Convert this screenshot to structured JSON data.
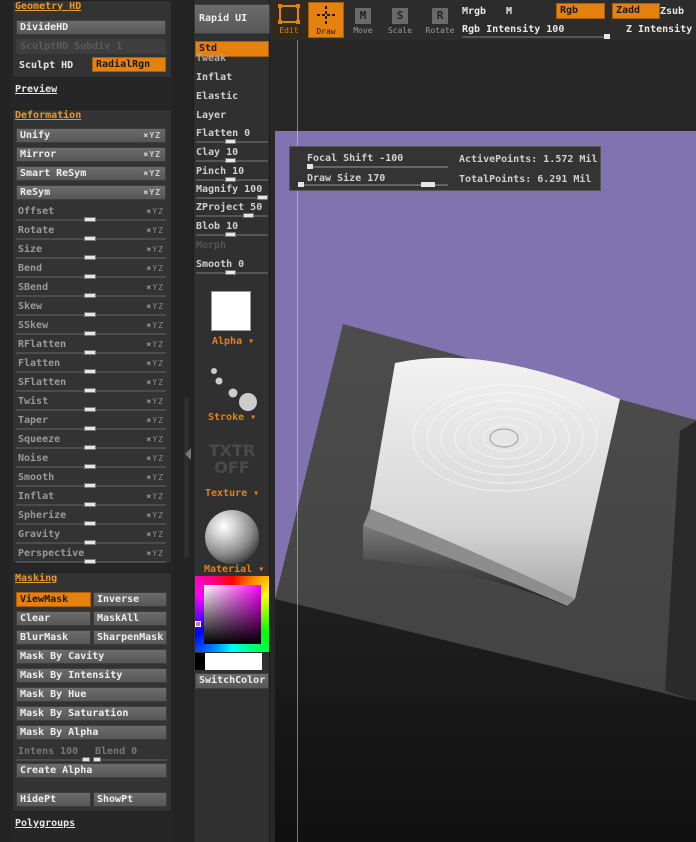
{
  "left_panel": {
    "geometry": {
      "title": "Geometry HD",
      "divide": "DivideHD",
      "sculpt_subdiv": "SculptHD Subdiv 1",
      "sculpt_hd": "Sculpt HD",
      "radial_rgn": "RadialRgn"
    },
    "preview": "Preview",
    "deformation": {
      "title": "Deformation",
      "buttons": [
        "Unify",
        "Mirror",
        "Smart ReSym",
        "ReSym"
      ],
      "xyz": "✖YZ",
      "sliders": [
        "Offset",
        "Rotate",
        "Size",
        "Bend",
        "SBend",
        "Skew",
        "SSkew",
        "RFlatten",
        "Flatten",
        "SFlatten",
        "Twist",
        "Taper",
        "Squeeze",
        "Noise",
        "Smooth",
        "Inflat",
        "Spherize",
        "Gravity",
        "Perspective"
      ]
    },
    "masking": {
      "title": "Masking",
      "viewmask": "ViewMask",
      "inverse": "Inverse",
      "clear": "Clear",
      "maskall": "MaskAll",
      "blurmask": "BlurMask",
      "sharpenmask": "SharpenMask",
      "by_cavity": "Mask By Cavity",
      "by_intensity": "Mask By Intensity",
      "by_hue": "Mask By Hue",
      "by_saturation": "Mask By Saturation",
      "by_alpha": "Mask By Alpha",
      "intens": "Intens 100",
      "blend": "Blend 0",
      "create_alpha": "Create Alpha",
      "hidept": "HidePt",
      "showpt": "ShowPt"
    },
    "polygroups": "Polygroups"
  },
  "brush_panel": {
    "rapid_ui": "Rapid UI",
    "std": "Std",
    "brushes": [
      {
        "label": "Tweak"
      },
      {
        "label": "Inflat"
      },
      {
        "label": "Elastic"
      },
      {
        "label": "Layer"
      },
      {
        "label": "Flatten 0"
      },
      {
        "label": "Clay 10"
      },
      {
        "label": "Pinch 10"
      },
      {
        "label": "Magnify 100"
      },
      {
        "label": "ZProject 50"
      },
      {
        "label": "Blob 10"
      },
      {
        "label": "Morph"
      },
      {
        "label": "Smooth 0"
      }
    ],
    "alpha": "Alpha",
    "stroke": "Stroke",
    "texture_off": "TXTR OFF",
    "texture": "Texture",
    "material": "Material",
    "switch_color": "SwitchColor"
  },
  "toolbar": {
    "edit": "Edit",
    "draw": "Draw",
    "move": "Move",
    "scale": "Scale",
    "rotate": "Rotate",
    "mrgb": "Mrgb",
    "m": "M",
    "rgb": "Rgb",
    "zadd": "Zadd",
    "zsub": "Zsub",
    "rgb_intensity": "Rgb Intensity 100",
    "z_intensity": "Z Intensity",
    "move_icon": "M",
    "scale_icon": "S",
    "rotate_icon": "R"
  },
  "viewport": {
    "focal_shift": "Focal Shift -100",
    "draw_size": "Draw Size 170",
    "active_points": "ActivePoints: 1.572  Mil",
    "total_points": "TotalPoints: 6.291  Mil"
  },
  "colors": {
    "accent": "#e5810e",
    "canvas": "#8173af",
    "panel": "#333333"
  }
}
